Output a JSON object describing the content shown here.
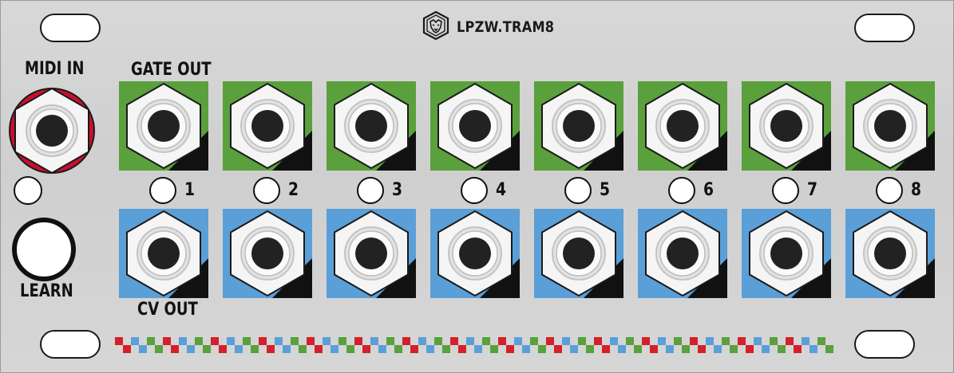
{
  "module": {
    "name": "LPZW.TRAM8",
    "logo_icon": "lion-head-icon"
  },
  "midi": {
    "label": "MIDI IN",
    "accent": "#c8102e"
  },
  "learn": {
    "label": "LEARN"
  },
  "gate": {
    "label": "GATE OUT",
    "color": "#5aa03c"
  },
  "cv": {
    "label": "CV OUT",
    "color": "#5b9fd8"
  },
  "channels": [
    "1",
    "2",
    "3",
    "4",
    "5",
    "6",
    "7",
    "8"
  ],
  "checker_colors": [
    "#d4202a",
    "#5aa03c",
    "#5b9fd8"
  ]
}
